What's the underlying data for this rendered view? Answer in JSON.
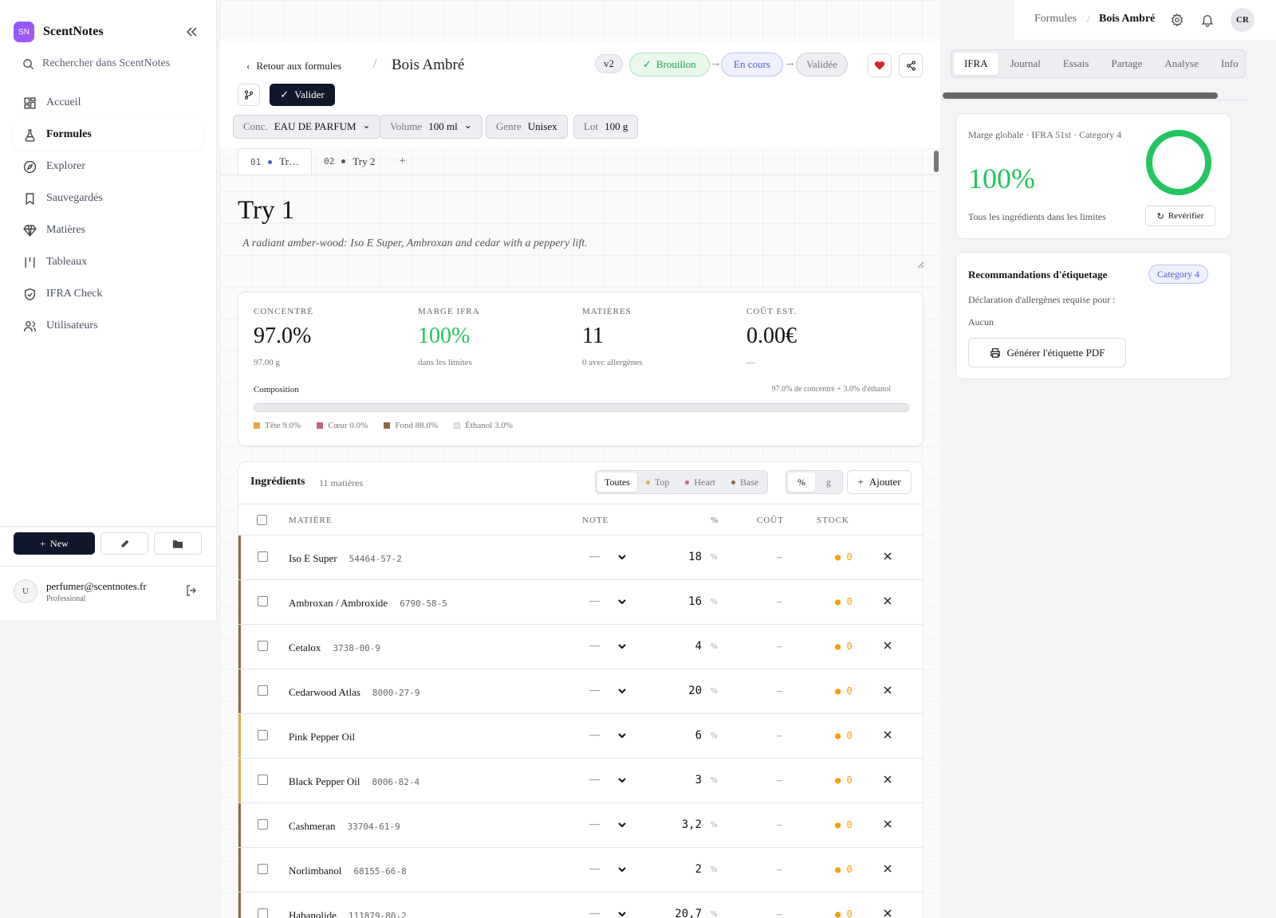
{
  "app": {
    "name": "ScentNotes",
    "logo_initials": "SN",
    "search_placeholder": "Rechercher dans ScentNotes"
  },
  "sidebar": {
    "items": [
      {
        "label": "Accueil",
        "icon": "home-grid-icon",
        "active": false
      },
      {
        "label": "Formules",
        "icon": "flask-icon",
        "active": true
      },
      {
        "label": "Explorer",
        "icon": "compass-icon",
        "active": false
      },
      {
        "label": "Sauvegardés",
        "icon": "bookmark-icon",
        "active": false
      },
      {
        "label": "Matières",
        "icon": "gem-icon",
        "active": false
      },
      {
        "label": "Tableaux",
        "icon": "columns-icon",
        "active": false
      },
      {
        "label": "IFRA Check",
        "icon": "shield-check-icon",
        "active": false
      },
      {
        "label": "Utilisateurs",
        "icon": "users-icon",
        "active": false
      }
    ],
    "new_label": "New",
    "user": {
      "initial": "U",
      "email": "perfumer@scentnotes.fr",
      "plan": "Professional"
    }
  },
  "topbar": {
    "crumb": "Formules",
    "separator": "/",
    "title": "Bois Ambré",
    "avatar": "CR"
  },
  "header": {
    "back_label": "Retour aux formules",
    "separator": "/",
    "title": "Bois Ambré",
    "version": "v2",
    "statuses": [
      "Brouillon",
      "En cours",
      "Validée"
    ],
    "status_arrow": "→",
    "validate_label": "Valider",
    "meta": [
      {
        "key": "Conc.",
        "value": "EAU DE PARFUM",
        "dropdown": true
      },
      {
        "key": "Volume",
        "value": "100 ml",
        "dropdown": true
      },
      {
        "key": "Genre",
        "value": "Unisex",
        "dropdown": false
      },
      {
        "key": "Lot",
        "value": "100 g",
        "dropdown": false
      }
    ]
  },
  "tries": {
    "tabs": [
      {
        "num": "01",
        "label": "Tr…",
        "dot_color": "#4f5bd5",
        "active": true
      },
      {
        "num": "02",
        "label": "Try 2",
        "dot_color": "#555555",
        "active": false
      }
    ],
    "add_label": "+",
    "title": "Try 1",
    "description": "A radiant amber-wood: Iso E Super, Ambroxan and cedar with a peppery lift."
  },
  "stats": {
    "items": [
      {
        "label": "Concentré",
        "value": "97.0%",
        "sub": "97.00 g",
        "green": false
      },
      {
        "label": "Marge IFRA",
        "value": "100%",
        "sub": "dans les limites",
        "green": true
      },
      {
        "label": "Matières",
        "value": "11",
        "sub": "0 avec allergènes",
        "green": false
      },
      {
        "label": "Coût est.",
        "value": "0.00€",
        "sub": "—",
        "green": false
      }
    ],
    "composition_label": "Composition",
    "composition_note": "97.0% de concentré + 3.0% d'éthanol",
    "legend": [
      {
        "label": "Tête 9.0%",
        "color": "#e5a84b"
      },
      {
        "label": "Cœur 0.0%",
        "color": "#c2608a"
      },
      {
        "label": "Fond 88.0%",
        "color": "#8b6a45"
      },
      {
        "label": "Éthanol 3.0%",
        "color": "#e5e7eb"
      }
    ]
  },
  "ingredients": {
    "title": "Ingrédients",
    "count": "11 matières",
    "filters": [
      {
        "label": "Toutes",
        "dot": null,
        "on": true
      },
      {
        "label": "Top",
        "dot": "#e5a84b",
        "on": false
      },
      {
        "label": "Heart",
        "dot": "#c2608a",
        "on": false
      },
      {
        "label": "Base",
        "dot": "#8b6a45",
        "on": false
      }
    ],
    "units": [
      {
        "label": "%",
        "on": true
      },
      {
        "label": "g",
        "on": false
      }
    ],
    "add_label": "Ajouter",
    "columns": {
      "material": "MATIÈRE",
      "note": "NOTE",
      "pct": "%",
      "cost": "COÛT",
      "stock": "STOCK"
    },
    "rows": [
      {
        "name": "Iso E Super",
        "cas": "54464-57-2",
        "note": "—",
        "pct": "18",
        "unit": "%",
        "cost": "–",
        "stock": "● 0",
        "accent": "#8b6a45"
      },
      {
        "name": "Ambroxan / Ambroxide",
        "cas": "6790-58-5",
        "note": "—",
        "pct": "16",
        "unit": "%",
        "cost": "–",
        "stock": "● 0",
        "accent": "#8b6a45"
      },
      {
        "name": "Cetalox",
        "cas": "3738-00-9",
        "note": "—",
        "pct": "4",
        "unit": "%",
        "cost": "–",
        "stock": "● 0",
        "accent": "#8b6a45"
      },
      {
        "name": "Cedarwood Atlas",
        "cas": "8000-27-9",
        "note": "—",
        "pct": "20",
        "unit": "%",
        "cost": "–",
        "stock": "● 0",
        "accent": "#8b6a45"
      },
      {
        "name": "Pink Pepper Oil",
        "cas": "",
        "note": "—",
        "pct": "6",
        "unit": "%",
        "cost": "–",
        "stock": "● 0",
        "accent": "#e5a84b"
      },
      {
        "name": "Black Pepper Oil",
        "cas": "8006-82-4",
        "note": "—",
        "pct": "3",
        "unit": "%",
        "cost": "–",
        "stock": "● 0",
        "accent": "#e5a84b"
      },
      {
        "name": "Cashmeran",
        "cas": "33704-61-9",
        "note": "—",
        "pct": "3,2",
        "unit": "%",
        "cost": "–",
        "stock": "● 0",
        "accent": "#8b6a45"
      },
      {
        "name": "Norlimbanol",
        "cas": "68155-66-8",
        "note": "—",
        "pct": "2",
        "unit": "%",
        "cost": "–",
        "stock": "● 0",
        "accent": "#8b6a45"
      },
      {
        "name": "Habanolide",
        "cas": "111879-80-2",
        "note": "—",
        "pct": "20,7",
        "unit": "%",
        "cost": "–",
        "stock": "● 0",
        "accent": "#8b6a45"
      }
    ]
  },
  "right_panel": {
    "tabs": [
      {
        "label": "IFRA",
        "on": true
      },
      {
        "label": "Journal",
        "on": false
      },
      {
        "label": "Essais",
        "on": false
      },
      {
        "label": "Partage",
        "on": false
      },
      {
        "label": "Analyse",
        "on": false
      },
      {
        "label": "Info",
        "on": false
      }
    ],
    "ifra": {
      "header": "Marge globale · IFRA 51st · Category 4",
      "value": "100%",
      "margin_fraction": 1.0,
      "status": "Tous les ingrédients dans les limites",
      "recheck_label": "Revérifier"
    },
    "labeling": {
      "title": "Recommandations d'étiquetage",
      "badge": "Category 4",
      "text": "Déclaration d'allergènes requise pour :",
      "value": "Aucun",
      "pdf_label": "Générer l'étiquette PDF"
    }
  },
  "colors": {
    "accent_dark": "#0f172a",
    "green": "#22c55e",
    "indigo": "#4f5bd5",
    "favorite": "#dc2626"
  }
}
